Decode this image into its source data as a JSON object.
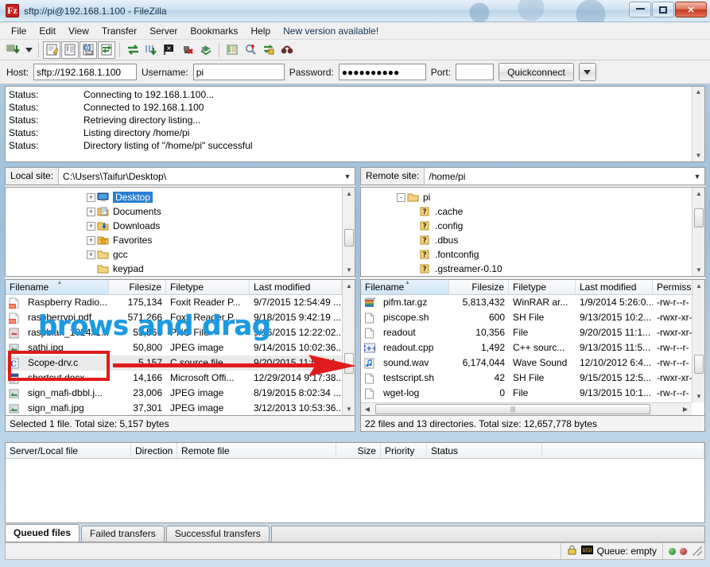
{
  "window": {
    "title": "sftp://pi@192.168.1.100 - FileZilla",
    "logo_text": "Fz",
    "minimize": "–",
    "maximize": "□",
    "close": "✕"
  },
  "menu": {
    "items": [
      {
        "label": "File"
      },
      {
        "label": "Edit"
      },
      {
        "label": "View"
      },
      {
        "label": "Transfer"
      },
      {
        "label": "Server"
      },
      {
        "label": "Bookmarks"
      },
      {
        "label": "Help"
      },
      {
        "label": "New version available!"
      }
    ]
  },
  "toolbar": {
    "buttons": [
      {
        "name": "site-manager-icon"
      },
      {
        "name": "site-manager-dropdown-icon"
      },
      {
        "name": "toggle-message-log-icon"
      },
      {
        "name": "toggle-local-tree-icon"
      },
      {
        "name": "toggle-remote-tree-icon"
      },
      {
        "name": "toggle-transfer-queue-icon"
      },
      {
        "name": "refresh-icon"
      },
      {
        "name": "process-queue-icon"
      },
      {
        "name": "cancel-operation-icon"
      },
      {
        "name": "disconnect-icon"
      },
      {
        "name": "reconnect-icon"
      },
      {
        "name": "filter-icon"
      },
      {
        "name": "directory-comparison-icon"
      },
      {
        "name": "synchronized-browsing-icon"
      },
      {
        "name": "search-remote-files-icon"
      }
    ]
  },
  "quickconnect": {
    "host_label": "Host:",
    "host_value": "sftp://192.168.1.100",
    "username_label": "Username:",
    "username_value": "pi",
    "password_label": "Password:",
    "password_value": "●●●●●●●●●●",
    "port_label": "Port:",
    "port_value": "",
    "port_placeholder": "",
    "connect_button": "Quickconnect",
    "dropdown_icon": "▾"
  },
  "status_log": {
    "entries": [
      {
        "key": "Status:",
        "message": "Connecting to 192.168.1.100..."
      },
      {
        "key": "Status:",
        "message": "Connected to 192.168.1.100"
      },
      {
        "key": "Status:",
        "message": "Retrieving directory listing..."
      },
      {
        "key": "Status:",
        "message": "Listing directory /home/pi"
      },
      {
        "key": "Status:",
        "message": "Directory listing of \"/home/pi\" successful"
      }
    ]
  },
  "local": {
    "site_label": "Local site:",
    "site_value": "C:\\Users\\Taifur\\Desktop\\",
    "tree": [
      {
        "label": "Desktop",
        "icon": "monitor-icon",
        "expander": "+",
        "selected": true
      },
      {
        "label": "Documents",
        "icon": "documents-folder-icon",
        "expander": "+",
        "selected": false
      },
      {
        "label": "Downloads",
        "icon": "downloads-folder-icon",
        "expander": "+",
        "selected": false
      },
      {
        "label": "Favorites",
        "icon": "favorites-folder-icon",
        "expander": "+",
        "selected": false
      },
      {
        "label": "gcc",
        "icon": "folder-icon",
        "expander": "+",
        "selected": false
      },
      {
        "label": "keypad",
        "icon": "folder-icon",
        "expander": "",
        "selected": false
      }
    ],
    "columns": [
      {
        "label": "Filename",
        "sorted": true
      },
      {
        "label": "Filesize",
        "sorted": false
      },
      {
        "label": "Filetype",
        "sorted": false
      },
      {
        "label": "Last modified",
        "sorted": false
      }
    ],
    "rows": [
      {
        "icon": "pdf-file-icon",
        "filename": "Raspberry Radio...",
        "filesize": "175,134",
        "filetype": "Foxit Reader P...",
        "modified": "9/7/2015 12:54:49 ...",
        "selected": false
      },
      {
        "icon": "pdf-file-icon",
        "filename": "raspberrypi.pdf",
        "filesize": "571,266",
        "filetype": "Foxit Reader P...",
        "modified": "9/18/2015 9:42:19 ...",
        "selected": false
      },
      {
        "icon": "png-file-icon",
        "filename": "raspbian_1024x1...",
        "filesize": "53,566",
        "filetype": "PNG File",
        "modified": "9/16/2015 12:22:02...",
        "selected": false
      },
      {
        "icon": "jpeg-file-icon",
        "filename": "sathi.jpg",
        "filesize": "50,800",
        "filetype": "JPEG image",
        "modified": "9/14/2015 10:02:36...",
        "selected": false
      },
      {
        "icon": "c-source-file-icon",
        "filename": "Scope-drv.c",
        "filesize": "5,157",
        "filetype": "C source file",
        "modified": "9/20/2015 11:01:44",
        "selected": true
      },
      {
        "icon": "doc-file-icon",
        "filename": "shortcut.docx",
        "filesize": "14,166",
        "filetype": "Microsoft Offi...",
        "modified": "12/29/2014 9:17:38...",
        "selected": false
      },
      {
        "icon": "jpeg-file-icon",
        "filename": "sign_mafi-dbbl.j...",
        "filesize": "23,006",
        "filetype": "JPEG image",
        "modified": "8/19/2015 8:02:34 ...",
        "selected": false
      },
      {
        "icon": "jpeg-file-icon",
        "filename": "sign_mafi.jpg",
        "filesize": "37,301",
        "filetype": "JPEG image",
        "modified": "3/12/2013 10:53:36...",
        "selected": false
      }
    ],
    "status": "Selected 1 file. Total size: 5,157 bytes"
  },
  "remote": {
    "site_label": "Remote site:",
    "site_value": "/home/pi",
    "tree": [
      {
        "label": "pi",
        "icon": "folder-icon",
        "expander": "-",
        "indent": 0
      },
      {
        "label": ".cache",
        "icon": "unknown-folder-icon",
        "expander": "",
        "indent": 1
      },
      {
        "label": ".config",
        "icon": "unknown-folder-icon",
        "expander": "",
        "indent": 1
      },
      {
        "label": ".dbus",
        "icon": "unknown-folder-icon",
        "expander": "",
        "indent": 1
      },
      {
        "label": ".fontconfig",
        "icon": "unknown-folder-icon",
        "expander": "",
        "indent": 1
      },
      {
        "label": ".gstreamer-0.10",
        "icon": "unknown-folder-icon",
        "expander": "",
        "indent": 1
      }
    ],
    "columns": [
      {
        "label": "Filename",
        "sorted": true
      },
      {
        "label": "Filesize",
        "sorted": false
      },
      {
        "label": "Filetype",
        "sorted": false
      },
      {
        "label": "Last modified",
        "sorted": false
      },
      {
        "label": "Permissi",
        "sorted": false
      }
    ],
    "rows": [
      {
        "icon": "archive-file-icon",
        "filename": "pifm.tar.gz",
        "filesize": "5,813,432",
        "filetype": "WinRAR ar...",
        "modified": "1/9/2014 5:26:0...",
        "permissions": "-rw-r--r-"
      },
      {
        "icon": "generic-file-icon",
        "filename": "piscope.sh",
        "filesize": "600",
        "filetype": "SH File",
        "modified": "9/13/2015 10:2...",
        "permissions": "-rwxr-xr-"
      },
      {
        "icon": "generic-file-icon",
        "filename": "readout",
        "filesize": "10,356",
        "filetype": "File",
        "modified": "9/20/2015 11:1...",
        "permissions": "-rwxr-xr-"
      },
      {
        "icon": "cpp-source-file-icon",
        "filename": "readout.cpp",
        "filesize": "1,492",
        "filetype": "C++ sourc...",
        "modified": "9/13/2015 11:5...",
        "permissions": "-rw-r--r-"
      },
      {
        "icon": "wave-sound-icon",
        "filename": "sound.wav",
        "filesize": "6,174,044",
        "filetype": "Wave Sound",
        "modified": "12/10/2012 6:4...",
        "permissions": "-rw-r--r-"
      },
      {
        "icon": "generic-file-icon",
        "filename": "testscript.sh",
        "filesize": "42",
        "filetype": "SH File",
        "modified": "9/15/2015 12:5...",
        "permissions": "-rwxr-xr-"
      },
      {
        "icon": "generic-file-icon",
        "filename": "wget-log",
        "filesize": "0",
        "filetype": "File",
        "modified": "9/13/2015 10:1...",
        "permissions": "-rw-r--r-"
      }
    ],
    "status": "22 files and 13 directories. Total size: 12,657,778 bytes"
  },
  "queue": {
    "columns": [
      {
        "label": "Server/Local file"
      },
      {
        "label": "Direction"
      },
      {
        "label": "Remote file"
      },
      {
        "label": "Size"
      },
      {
        "label": "Priority"
      },
      {
        "label": "Status"
      }
    ],
    "rows": []
  },
  "bottom_tabs": [
    {
      "label": "Queued files",
      "active": true
    },
    {
      "label": "Failed transfers",
      "active": false
    },
    {
      "label": "Successful transfers",
      "active": false
    }
  ],
  "statusbar": {
    "lock_icon": "lock-icon",
    "cert_icon": "certificate-icon",
    "queue_text": "Queue: empty",
    "led_green": "#1d7a1d",
    "led_red": "#a01414"
  },
  "annotations": {
    "overlay_text": "brows and drag",
    "overlay_color": "#1c9ae0",
    "highlight_color": "#e01b1b"
  }
}
